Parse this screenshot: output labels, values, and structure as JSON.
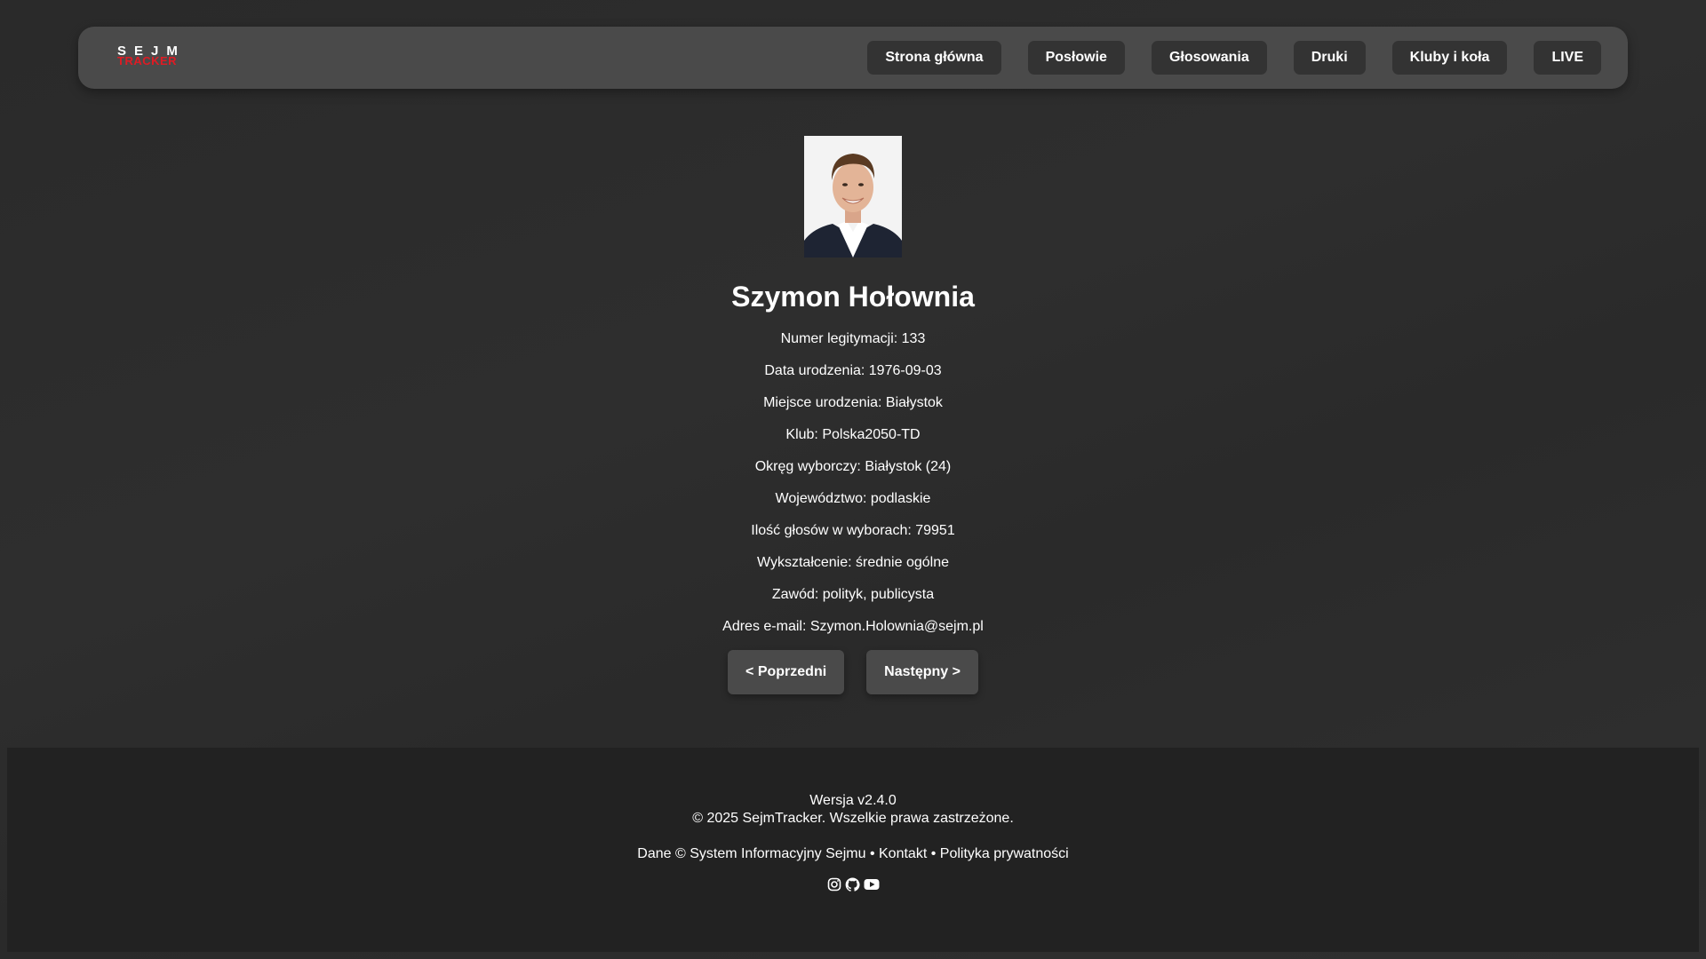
{
  "header": {
    "logo_top": "SEJM",
    "logo_bottom": "TRACKER",
    "nav": [
      {
        "label": "Strona główna"
      },
      {
        "label": "Posłowie"
      },
      {
        "label": "Głosowania"
      },
      {
        "label": "Druki"
      },
      {
        "label": "Kluby i koła"
      },
      {
        "label": "LIVE"
      }
    ]
  },
  "profile": {
    "name": "Szymon Hołownia",
    "details": [
      "Numer legitymacji: 133",
      "Data urodzenia: 1976-09-03",
      "Miejsce urodzenia: Białystok",
      "Klub: Polska2050-TD",
      "Okręg wyborczy: Białystok (24)",
      "Województwo: podlaskie",
      "Ilość głosów w wyborach: 79951",
      "Wykształcenie: średnie ogólne",
      "Zawód: polityk, publicysta",
      "Adres e-mail: Szymon.Holownia@sejm.pl"
    ]
  },
  "pager": {
    "prev_label": "< Poprzedni",
    "next_label": "Następny >"
  },
  "footer": {
    "version": "Wersja v2.4.0",
    "copyright": "© 2025 SejmTracker. Wszelkie prawa zastrzeżone.",
    "data_source": "Dane © System Informacyjny Sejmu",
    "separator": "•",
    "contact": "Kontakt",
    "privacy": "Polityka prywatności",
    "icons": [
      "instagram-icon",
      "github-icon",
      "youtube-icon"
    ]
  }
}
